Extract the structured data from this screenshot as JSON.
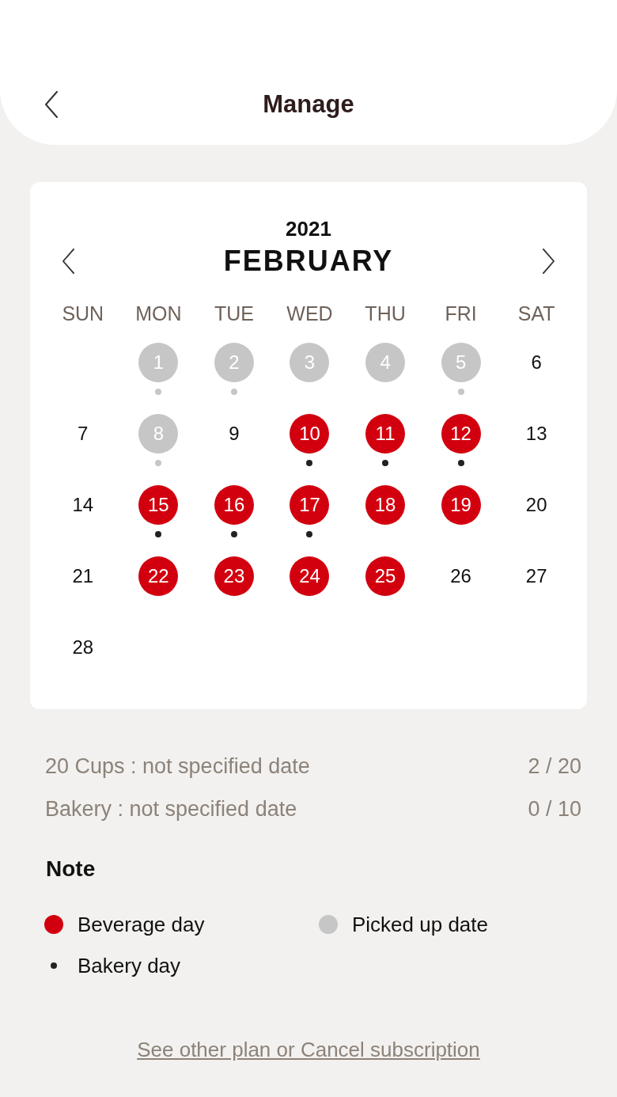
{
  "header": {
    "title": "Manage"
  },
  "calendar": {
    "year": "2021",
    "month": "FEBRUARY",
    "weekdays": [
      "SUN",
      "MON",
      "TUE",
      "WED",
      "THU",
      "FRI",
      "SAT"
    ],
    "weeks": [
      [
        {
          "label": "1",
          "kind": "picked",
          "bakery": true
        },
        {
          "label": "2",
          "kind": "picked",
          "bakery": true
        },
        {
          "label": "3",
          "kind": "picked",
          "bakery": false
        },
        {
          "label": "4",
          "kind": "picked",
          "bakery": false
        },
        {
          "label": "5",
          "kind": "picked",
          "bakery": true
        },
        {
          "label": "6",
          "kind": "plain",
          "bakery": false
        }
      ],
      [
        {
          "label": "7",
          "kind": "plain",
          "bakery": false
        },
        {
          "label": "8",
          "kind": "picked",
          "bakery": true
        },
        {
          "label": "9",
          "kind": "plain",
          "bakery": false
        },
        {
          "label": "10",
          "kind": "beverage",
          "bakery": true
        },
        {
          "label": "11",
          "kind": "beverage",
          "bakery": true
        },
        {
          "label": "12",
          "kind": "beverage",
          "bakery": true
        },
        {
          "label": "13",
          "kind": "plain",
          "bakery": false
        }
      ],
      [
        {
          "label": "14",
          "kind": "plain",
          "bakery": false
        },
        {
          "label": "15",
          "kind": "beverage",
          "bakery": true
        },
        {
          "label": "16",
          "kind": "beverage",
          "bakery": true
        },
        {
          "label": "17",
          "kind": "beverage",
          "bakery": true
        },
        {
          "label": "18",
          "kind": "beverage",
          "bakery": false
        },
        {
          "label": "19",
          "kind": "beverage",
          "bakery": false
        },
        {
          "label": "20",
          "kind": "plain",
          "bakery": false
        }
      ],
      [
        {
          "label": "21",
          "kind": "plain",
          "bakery": false
        },
        {
          "label": "22",
          "kind": "beverage",
          "bakery": false
        },
        {
          "label": "23",
          "kind": "beverage",
          "bakery": false
        },
        {
          "label": "24",
          "kind": "beverage",
          "bakery": false
        },
        {
          "label": "25",
          "kind": "beverage",
          "bakery": false
        },
        {
          "label": "26",
          "kind": "plain",
          "bakery": false
        },
        {
          "label": "27",
          "kind": "plain",
          "bakery": false
        }
      ],
      [
        {
          "label": "28",
          "kind": "plain",
          "bakery": false
        }
      ]
    ]
  },
  "summary": [
    {
      "label": "20 Cups : not specified date",
      "count": "2 / 20"
    },
    {
      "label": "Bakery : not specified date",
      "count": "0 / 10"
    }
  ],
  "note": {
    "title": "Note",
    "legend": [
      {
        "kind": "beverage",
        "label": "Beverage day"
      },
      {
        "kind": "picked",
        "label": "Picked up date"
      },
      {
        "kind": "bakery",
        "label": "Bakery day"
      }
    ]
  },
  "footer_link": "See other plan or Cancel subscription"
}
